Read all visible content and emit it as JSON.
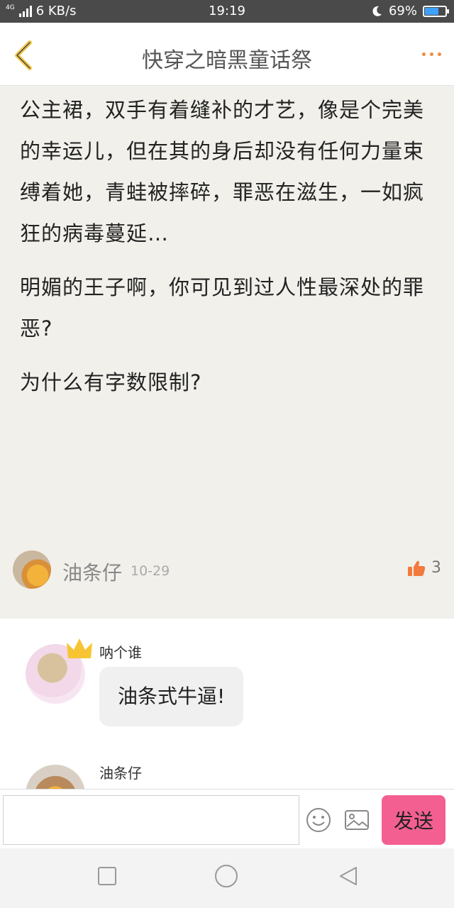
{
  "status_bar": {
    "network_type": "4G",
    "speed": "6 KB/s",
    "time": "19:19",
    "battery": "69%",
    "battery_level": 0.69,
    "icons": [
      "signal-icon",
      "moon-icon",
      "battery-icon"
    ]
  },
  "nav": {
    "title": "快穿之暗黑童话祭",
    "back_icon": "chevron-left-icon",
    "more_icon": "more-dots-icon",
    "accent_color": "#f08a3a",
    "back_color": "#f0c64a"
  },
  "article": {
    "paragraphs": [
      "公主裙，双手有着缝补的才艺，像是个完美的幸运儿，但在其的身后却没有任何力量束缚着她，青蛙被摔碎，罪恶在滋生，一如疯狂的病毒蔓延…",
      "明媚的王子啊，你可见到过人性最深处的罪恶?",
      "为什么有字数限制?"
    ],
    "author": "油条仔",
    "date": "10-29",
    "likes": "3",
    "like_icon": "thumbs-up-icon"
  },
  "comments": [
    {
      "name": "呐个谁",
      "text": "油条式牛逼!",
      "badge_icon": "crown-icon"
    },
    {
      "name": "油条仔",
      "text": ""
    }
  ],
  "input_bar": {
    "placeholder": "",
    "send_label": "发送",
    "send_color": "#f45f92",
    "icons": [
      "emoji-icon",
      "image-icon"
    ]
  },
  "system_nav": {
    "icons": [
      "recent-apps-icon",
      "home-icon",
      "back-triangle-icon"
    ]
  }
}
